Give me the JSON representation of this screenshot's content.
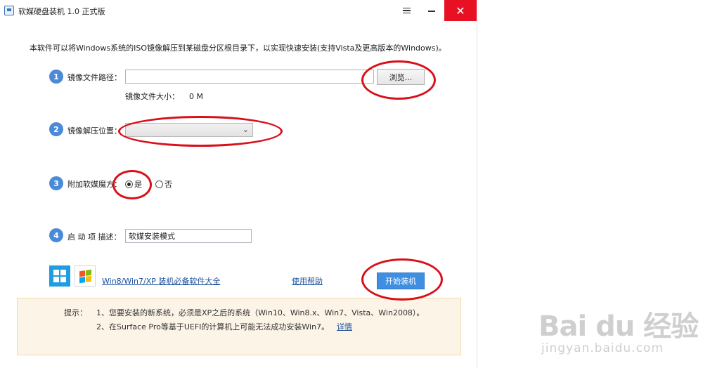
{
  "window": {
    "title": "软媒硬盘装机 1.0 正式版",
    "close_glyph": "✕"
  },
  "intro": "本软件可以将Windows系统的ISO镜像解压到某磁盘分区根目录下，以实现快速安装(支持Vista及更高版本的Windows)。",
  "steps": {
    "s1": {
      "num": "1",
      "label": "镜像文件路径：",
      "input_value": "",
      "browse_label": "浏览...",
      "size_label": "镜像文件大小：",
      "size_value": "0 M"
    },
    "s2": {
      "num": "2",
      "label": "镜像解压位置：",
      "selected": "",
      "chevron": "⌄"
    },
    "s3": {
      "num": "3",
      "label": "附加软媒魔方：",
      "yes_label": "是",
      "no_label": "否",
      "selected": "yes"
    },
    "s4": {
      "num": "4",
      "label": "启 动 项 描述：",
      "input_value": "软媒安装模式"
    }
  },
  "footer": {
    "software_link": "Win8/Win7/XP 装机必备软件大全",
    "help_link": "使用帮助",
    "start_button": "开始装机"
  },
  "tips": {
    "prefix": "提示：",
    "line1": "1、您要安装的新系统，必须是XP之后的系统（Win10、Win8.x、Win7、Vista、Win2008）。",
    "line2": "2、在Surface Pro等基于UEFI的计算机上可能无法成功安装Win7。",
    "detail_link": "详情"
  },
  "watermark": {
    "text": "Bai du 经验",
    "url": "jingyan.baidu.com"
  },
  "colors": {
    "accent": "#3e8ee2",
    "step_circle": "#4a8ad6",
    "close_red": "#e81123",
    "annotation_red": "#d8101a",
    "tip_bg": "#fcf4e6"
  }
}
